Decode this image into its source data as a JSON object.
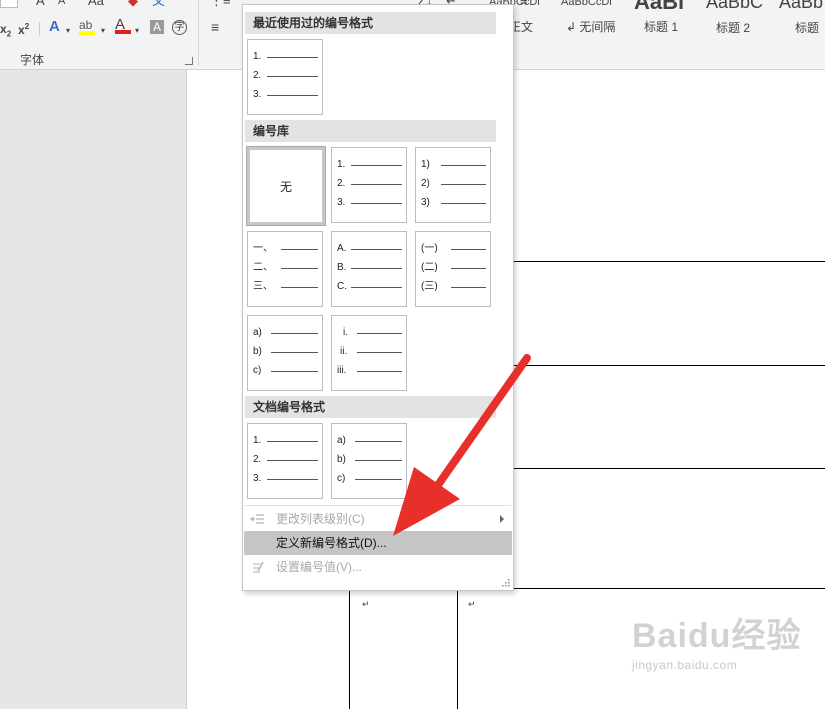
{
  "ribbon": {
    "font_group_label": "字体",
    "styles": [
      {
        "sample": "AaBbCcDi",
        "name": "正文"
      },
      {
        "sample": "AaBbCcDi",
        "name": "↲ 无间隔"
      },
      {
        "sample": "AaBl",
        "name": "标题 1"
      },
      {
        "sample": "AaBbC",
        "name": "标题 2"
      },
      {
        "sample": "AaBb",
        "name": "标题"
      }
    ]
  },
  "menu": {
    "recent_header": "最近使用过的编号格式",
    "library_header": "编号库",
    "document_header": "文档编号格式",
    "recent_tiles": [
      {
        "marks": [
          "1.",
          "2.",
          "3."
        ]
      }
    ],
    "library_tiles": [
      {
        "none_label": "无"
      },
      {
        "marks": [
          "1.",
          "2.",
          "3."
        ]
      },
      {
        "marks": [
          "1)",
          "2)",
          "3)"
        ]
      },
      {
        "marks": [
          "一、",
          "二、",
          "三、"
        ]
      },
      {
        "marks": [
          "A.",
          "B.",
          "C."
        ]
      },
      {
        "marks": [
          "(一)",
          "(二)",
          "(三)"
        ]
      },
      {
        "marks": [
          "a)",
          "b)",
          "c)"
        ]
      },
      {
        "marks": [
          "i.",
          "ii.",
          "iii."
        ]
      }
    ],
    "document_tiles": [
      {
        "marks": [
          "1.",
          "2.",
          "3."
        ]
      },
      {
        "marks": [
          "a)",
          "b)",
          "c)"
        ]
      }
    ],
    "items": {
      "change_level": "更改列表级别(C)",
      "define_new": "定义新编号格式(D)...",
      "set_value": "设置编号值(V)..."
    }
  },
  "document": {
    "paragraph_mark": "↵"
  },
  "watermark": {
    "logo": "Baidu经验",
    "url": "jingyan.baidu.com"
  },
  "colors": {
    "arrow": "#e8302b",
    "hover_item": "#c5c5c5",
    "section_header": "#e3e3e3"
  }
}
